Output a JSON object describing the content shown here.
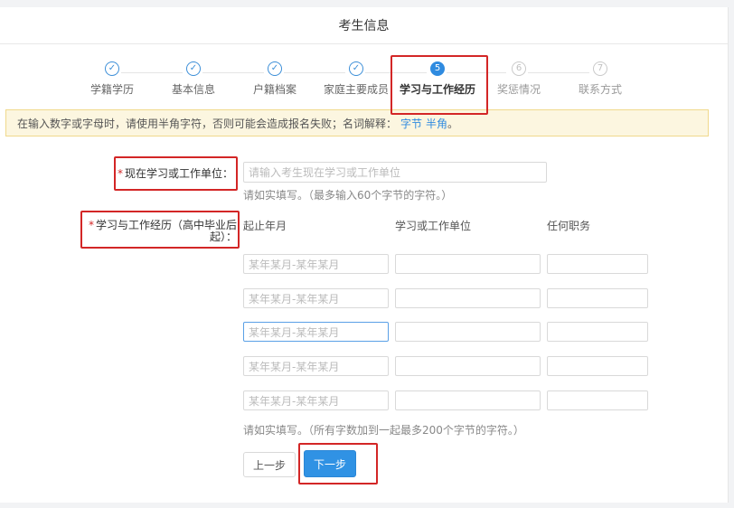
{
  "header": {
    "title": "考生信息"
  },
  "steps": [
    {
      "label": "学籍学历",
      "state": "done",
      "mark": "✓"
    },
    {
      "label": "基本信息",
      "state": "done",
      "mark": "✓"
    },
    {
      "label": "户籍档案",
      "state": "done",
      "mark": "✓"
    },
    {
      "label": "家庭主要成员",
      "state": "done",
      "mark": "✓"
    },
    {
      "label": "学习与工作经历",
      "state": "active",
      "mark": "5"
    },
    {
      "label": "奖惩情况",
      "state": "todo",
      "mark": "6"
    },
    {
      "label": "联系方式",
      "state": "todo",
      "mark": "7"
    }
  ],
  "notice": {
    "text": "在输入数字或字母时，请使用半角字符，否则可能会造成报名失败；名词解释：",
    "link1": "字节",
    "link2": "半角",
    "end": "。"
  },
  "current_unit": {
    "required_mark": "*",
    "label": "现在学习或工作单位：",
    "placeholder": "请输入考生现在学习或工作单位",
    "hint": "请如实填写。（最多输入60个字节的字符。）"
  },
  "history": {
    "required_mark": "*",
    "label_line1": "学习与工作经历（高中毕业后",
    "label_line2": "起）：",
    "columns": [
      "起止年月",
      "学习或工作单位",
      "任何职务"
    ],
    "rows": [
      {
        "period_placeholder": "某年某月-某年某月",
        "unit": "",
        "position": ""
      },
      {
        "period_placeholder": "某年某月-某年某月",
        "unit": "",
        "position": ""
      },
      {
        "period_placeholder": "某年某月-某年某月",
        "unit": "",
        "position": ""
      },
      {
        "period_placeholder": "某年某月-某年某月",
        "unit": "",
        "position": ""
      },
      {
        "period_placeholder": "某年某月-某年某月",
        "unit": "",
        "position": ""
      }
    ],
    "hint": "请如实填写。（所有字数加到一起最多200个字节的字符。）"
  },
  "buttons": {
    "prev": "上一步",
    "next": "下一步"
  },
  "colors": {
    "accent": "#3092e4",
    "highlight": "#d32626",
    "notice_bg": "#fcf6e0"
  }
}
